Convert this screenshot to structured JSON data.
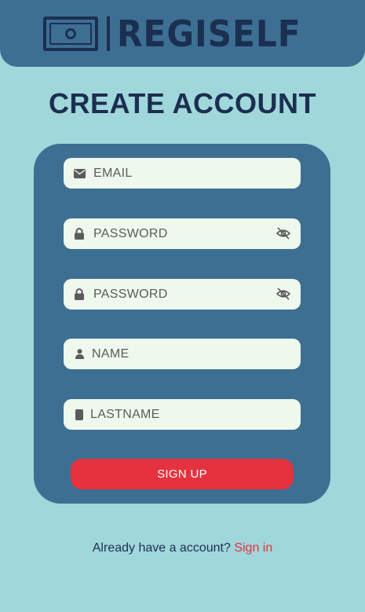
{
  "header": {
    "logo_text": "REGISELF",
    "logo_icon": "money-bill-icon"
  },
  "page_title": "CREATE ACCOUNT",
  "form": {
    "email_placeholder": "EMAIL",
    "password_placeholder": "PASSWORD",
    "confirm_password_placeholder": "PASSWORD",
    "name_placeholder": "NAME",
    "lastname_placeholder": "LASTNAME",
    "signup_label": "SIGN UP"
  },
  "footer": {
    "prompt": "Already have a account?",
    "signin_label": "Sign in"
  },
  "colors": {
    "background": "#a0d7da",
    "panel": "#3d6f93",
    "accent": "#e5323f",
    "navy": "#1b2f51",
    "field": "#eef8ec"
  }
}
